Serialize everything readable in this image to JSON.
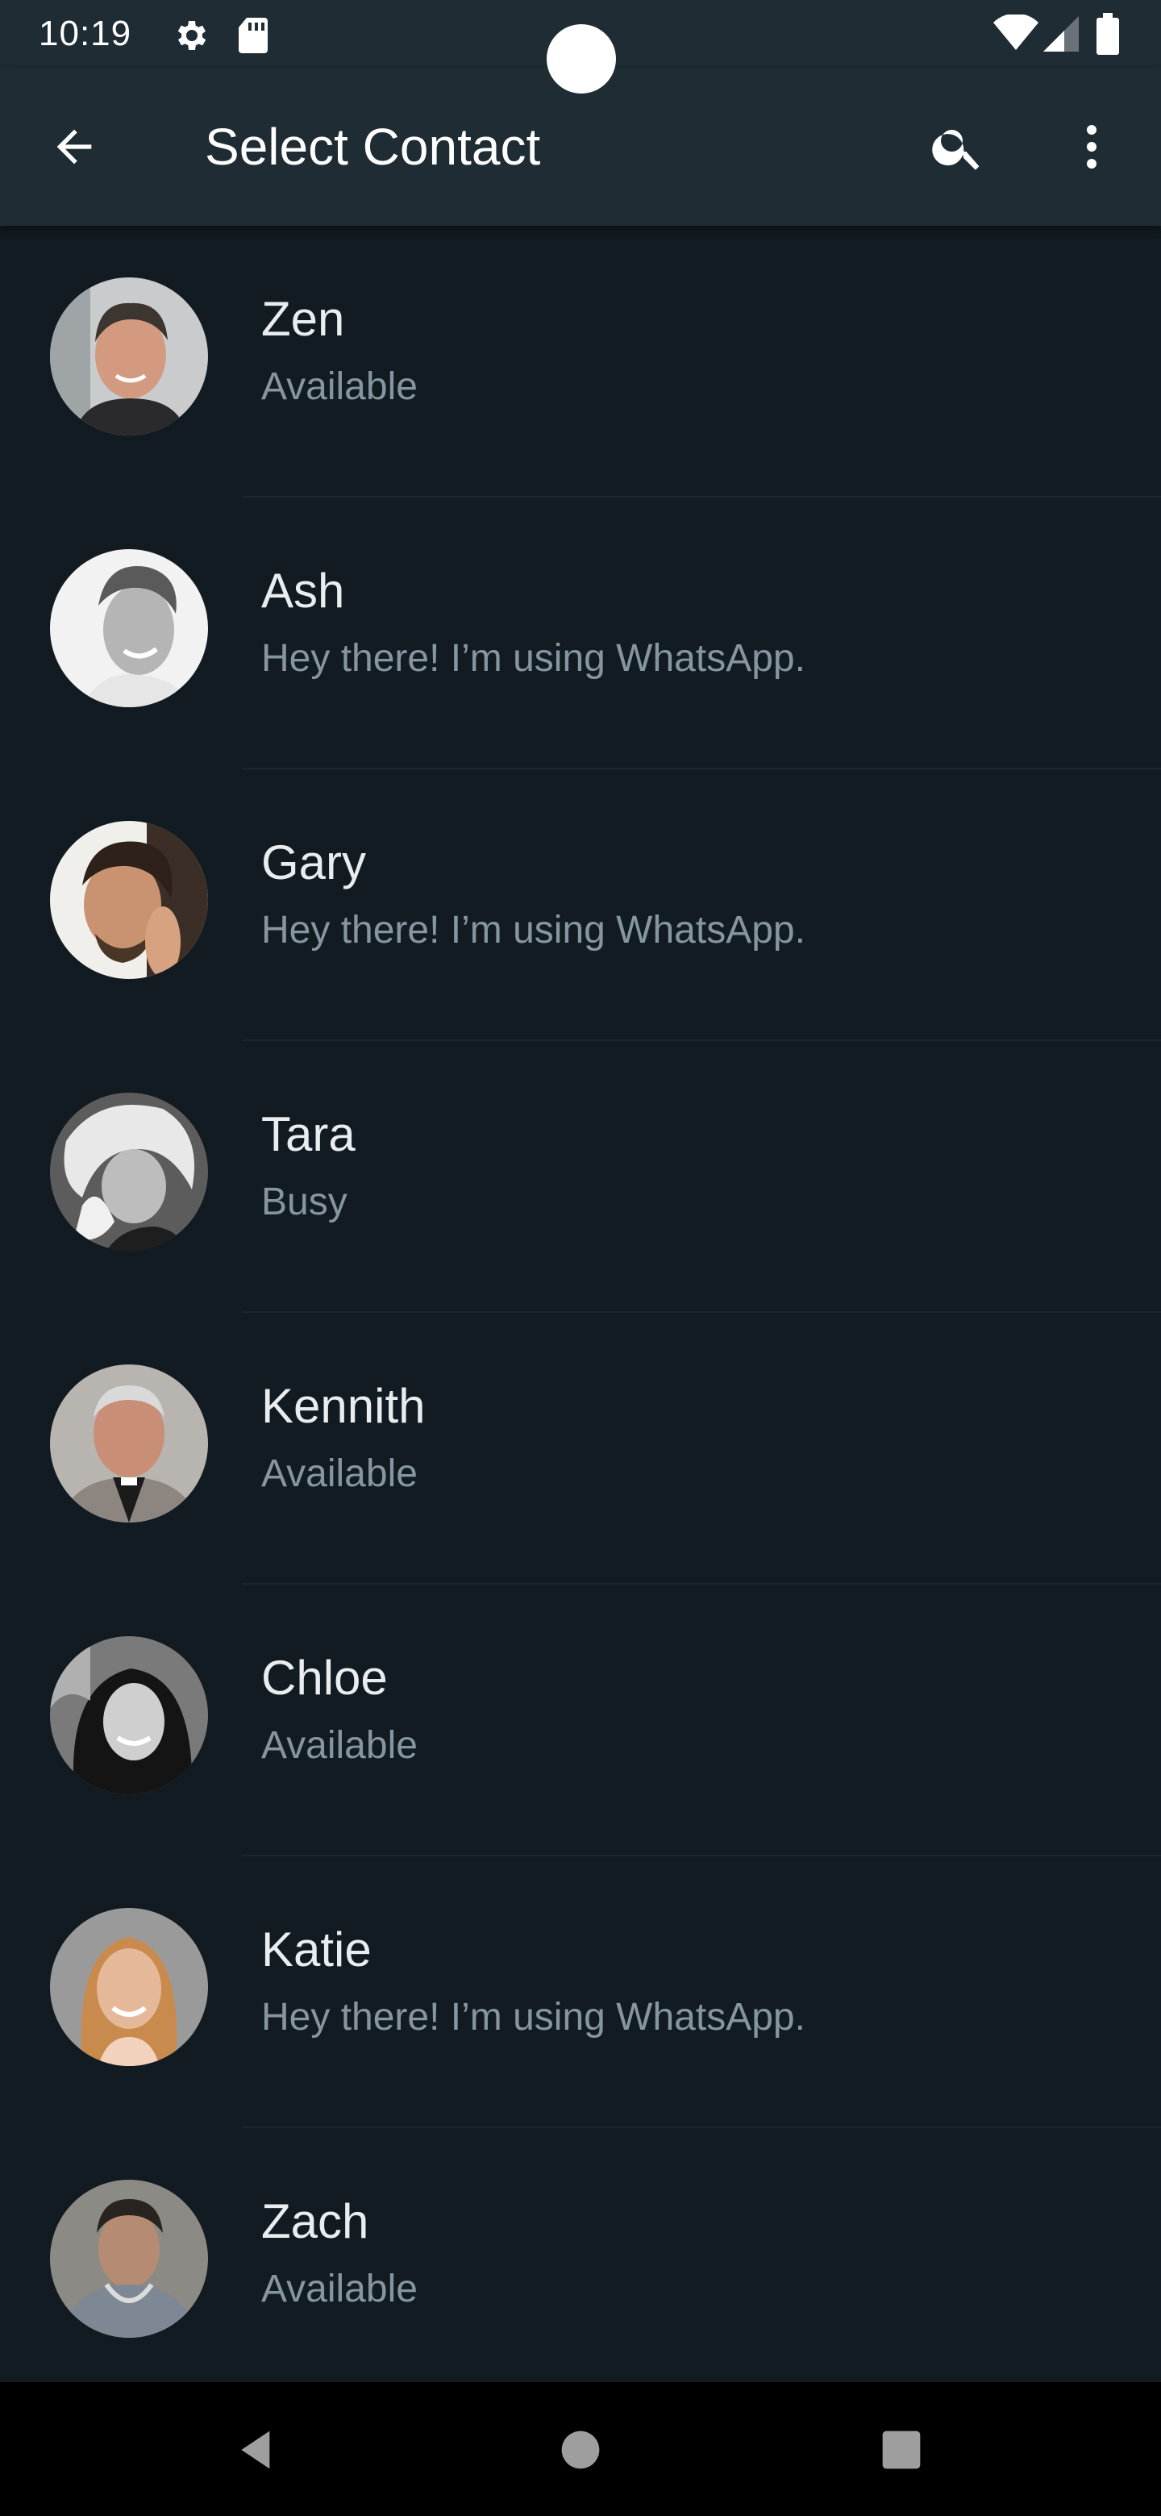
{
  "status_bar": {
    "time": "10:19",
    "icons": [
      "gear-icon",
      "sd-card-icon",
      "wifi-icon",
      "cellular-signal-icon",
      "battery-icon"
    ]
  },
  "app_bar": {
    "title": "Select Contact",
    "back_icon": "arrow-back-icon",
    "search_icon": "search-icon",
    "more_icon": "more-vert-icon"
  },
  "contacts": [
    {
      "name": "Zen",
      "status": "Available"
    },
    {
      "name": "Ash",
      "status": "Hey there! I’m using WhatsApp."
    },
    {
      "name": "Gary",
      "status": "Hey there! I’m using WhatsApp."
    },
    {
      "name": "Tara",
      "status": "Busy"
    },
    {
      "name": "Kennith",
      "status": "Available"
    },
    {
      "name": "Chloe",
      "status": "Available"
    },
    {
      "name": "Katie",
      "status": "Hey there! I’m using WhatsApp."
    },
    {
      "name": "Zach",
      "status": "Available"
    }
  ],
  "nav_bar": {
    "icons": [
      "back-triangle-icon",
      "home-circle-icon",
      "recents-square-icon"
    ]
  },
  "colors": {
    "background": "#121b22",
    "app_bar": "#1f2c34",
    "primary_text": "#e9edef",
    "secondary_text": "#8696a0"
  }
}
